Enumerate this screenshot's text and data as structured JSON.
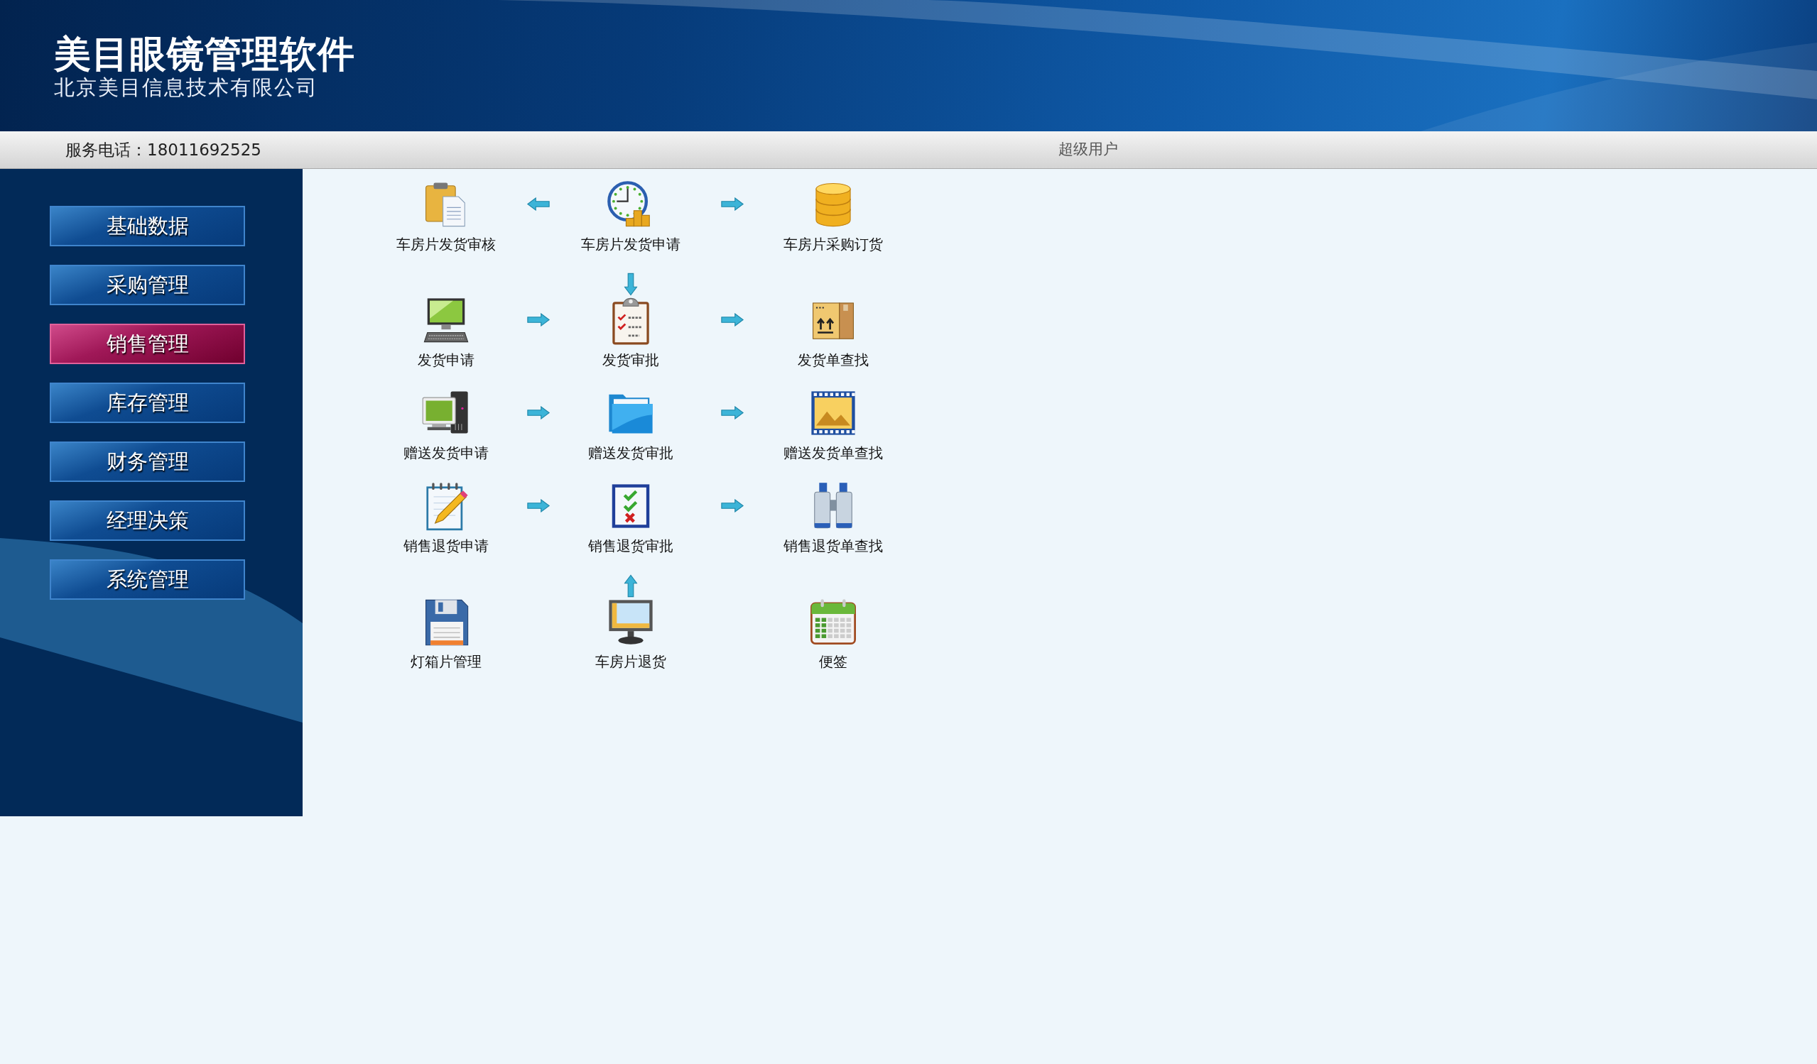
{
  "header": {
    "title": "美目眼镜管理软件",
    "subtitle": "北京美目信息技术有限公司"
  },
  "info_bar": {
    "phone": "服务电话：18011692525",
    "user": "超级用户"
  },
  "sidebar": {
    "items": [
      {
        "label": "基础数据",
        "selected": false
      },
      {
        "label": "采购管理",
        "selected": false
      },
      {
        "label": "销售管理",
        "selected": true
      },
      {
        "label": "库存管理",
        "selected": false
      },
      {
        "label": "财务管理",
        "selected": false
      },
      {
        "label": "经理决策",
        "selected": false
      },
      {
        "label": "系统管理",
        "selected": false
      }
    ]
  },
  "flow": {
    "rows": [
      {
        "kind": "items",
        "cells": [
          {
            "kind": "item",
            "label": "车房片发货审核"
          },
          {
            "kind": "arrow_left"
          },
          {
            "kind": "item",
            "label": "车房片发货申请"
          },
          {
            "kind": "arrow_right"
          },
          {
            "kind": "item",
            "label": "车房片采购订货"
          }
        ]
      },
      {
        "kind": "links",
        "cells": [
          {
            "kind": "blank"
          },
          {
            "kind": "blank"
          },
          {
            "kind": "arrow_down"
          },
          {
            "kind": "blank"
          },
          {
            "kind": "blank"
          }
        ]
      },
      {
        "kind": "items",
        "cells": [
          {
            "kind": "item",
            "label": "发货申请"
          },
          {
            "kind": "arrow_right"
          },
          {
            "kind": "item",
            "label": "发货审批"
          },
          {
            "kind": "arrow_right"
          },
          {
            "kind": "item",
            "label": "发货单查找"
          }
        ]
      },
      {
        "kind": "items",
        "cells": [
          {
            "kind": "item",
            "label": "赠送发货申请"
          },
          {
            "kind": "arrow_right"
          },
          {
            "kind": "item",
            "label": "赠送发货审批"
          },
          {
            "kind": "arrow_right"
          },
          {
            "kind": "item",
            "label": "赠送发货单查找"
          }
        ]
      },
      {
        "kind": "items",
        "cells": [
          {
            "kind": "item",
            "label": "销售退货申请"
          },
          {
            "kind": "arrow_right"
          },
          {
            "kind": "item",
            "label": "销售退货审批"
          },
          {
            "kind": "arrow_right"
          },
          {
            "kind": "item",
            "label": "销售退货单查找"
          }
        ]
      },
      {
        "kind": "links",
        "cells": [
          {
            "kind": "blank"
          },
          {
            "kind": "blank"
          },
          {
            "kind": "arrow_up"
          },
          {
            "kind": "blank"
          },
          {
            "kind": "blank"
          }
        ]
      },
      {
        "kind": "items",
        "cells": [
          {
            "kind": "item",
            "label": "灯箱片管理"
          },
          {
            "kind": "blank"
          },
          {
            "kind": "item",
            "label": "车房片退货"
          },
          {
            "kind": "blank"
          },
          {
            "kind": "item",
            "label": "便签"
          }
        ]
      }
    ]
  }
}
